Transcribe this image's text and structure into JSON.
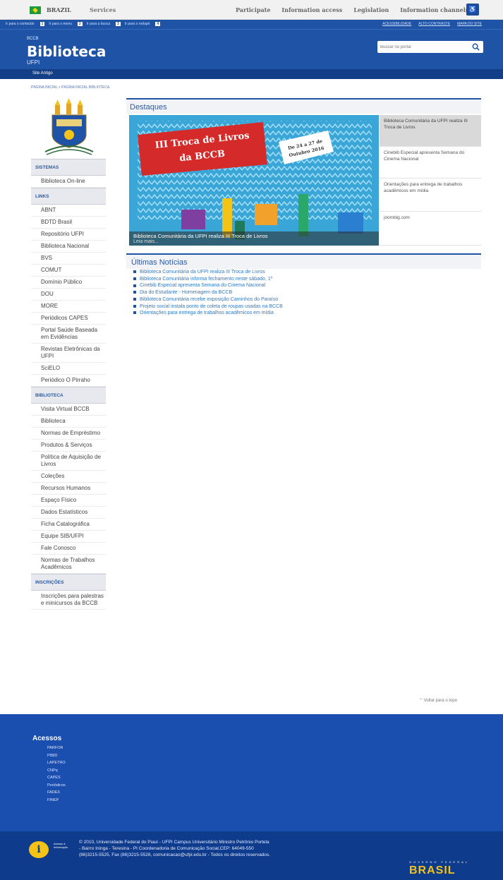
{
  "gov_bar": {
    "country": "BRAZIL",
    "services": "Services",
    "links": [
      "Participate",
      "Information access",
      "Legislation",
      "Information channels"
    ]
  },
  "header": {
    "skip_links": [
      "Ir para o conteúdo",
      "Ir para o menu",
      "Ir para a busca",
      "Ir para o rodapé"
    ],
    "right_links": [
      "ACESSIBILIDADE",
      "ALTO CONTRASTE",
      "MAPA DO SITE"
    ],
    "brand_small": "BCCB",
    "brand_title": "Biblioteca",
    "brand_sub": "UFPI",
    "search_placeholder": "Buscar no portal",
    "nav_item": "Site Antigo",
    "breadcrumb": "PÁGINA INICIAL > PÁGINA INICIAL BIBLIOTECA"
  },
  "sidebar": {
    "sistemas_title": "SISTEMAS",
    "sistemas_items": [
      "Biblioteca On-line"
    ],
    "links_title": "LINKS",
    "links_items": [
      "ABNT",
      "BDTD Brasil",
      "Repositório UFPI",
      "Biblioteca Nacional",
      "BVS",
      "COMUT",
      "Domínio Público",
      "DOU",
      "MORE",
      "Periódicos CAPES",
      "Portal Saúde Baseada em Evidências",
      "Revistas Eletrônicas da UFPI",
      "SciELO",
      "Periódico O Pirraho"
    ],
    "biblioteca_title": "BIBLIOTECA",
    "biblioteca_items": [
      "Visita Virtual BCCB",
      "Biblioteca",
      "Normas de Empréstimo",
      "Produtos & Serviços",
      "Política de Aquisição de Livros",
      "Coleções",
      "Recursos Humanos",
      "Espaço Físico",
      "Dados Estatísticos",
      "Ficha Catalográfica",
      "Equipe SIB/UFPI",
      "Fale Conosco",
      "Normas de Trabalhos Acadêmicos"
    ],
    "inscricoes_title": "INSCRIÇÕES",
    "inscricoes_items": [
      "Inscrições para palestras e minicursos da BCCB"
    ]
  },
  "destaques": {
    "title": "Destaques",
    "banner_title_1": "III Troca de Livros",
    "banner_title_2": "da BCCB",
    "banner_date_1": "De 24 a 27 de",
    "banner_date_2": "Outubro 2016",
    "caption": "Biblioteca Comunitária da UFPI realiza III Troca de Livros",
    "caption_more": "Leia mais...",
    "items": [
      "Biblioteca Comunitária da UFPI realiza III Troca de Livros",
      "Cinebib Especial apresenta Semana do Cinema Nacional",
      "Orientações para entrega de trabalhos acadêmicos em mídia",
      "joombig.com"
    ]
  },
  "ultimas": {
    "title": "Últimas Notícias",
    "items": [
      "Biblioteca Comunitária da UFPI realiza III Troca de Livros",
      "Biblioteca Comunitária informa fechamento neste sábado, 1º",
      "Cinebib Especial apresenta Semana do Cinema Nacional",
      "Dia do Estudante - Homenagem da BCCB",
      "Biblioteca Comunitária recebe exposição Caminhos do Paraíso",
      "Projeto social instala ponto de coleta de roupas usadas na BCCB",
      "Orientações para entrega de trabalhos acadêmicos em mídia"
    ]
  },
  "back_to_top": "Voltar para o topo",
  "footer": {
    "title": "Acessos",
    "items": [
      "PARFOR",
      "PIBID",
      "LAPETRO",
      "CNPq",
      "CAPES",
      "Periódicos",
      "FADEX",
      "FINEP"
    ],
    "info_label_1": "Acesso à",
    "info_label_2": "Informação",
    "copyright_1": "© 2010, Universidade Federal do Piauí - UFPI Campus Universitário Ministro Petrônio Portela",
    "copyright_2": "- Bairro Ininga - Teresina - PI Coordenadoria de Comunicação Social,CEP: 64049-550",
    "copyright_3": "(86)3215-5525, Fax (86)3215-5526, comunicacao@ufpi.edu.br - Todos os direitos reservados.",
    "gov_small": "GOVERNO FEDERAL",
    "gov_big": "BRASIL"
  },
  "colors": {
    "primary_blue": "#1f53a5",
    "nav_blue": "#123f88",
    "footer_blue": "#1a4fb0",
    "accent_yellow": "#f3c317",
    "banner_red": "#d42a2a"
  }
}
